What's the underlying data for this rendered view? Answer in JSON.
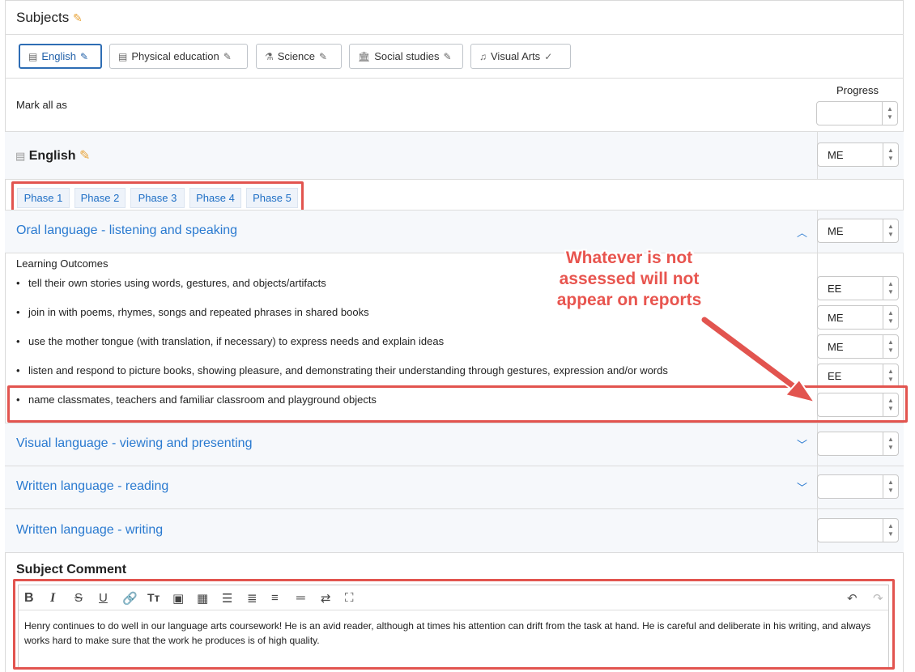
{
  "header": {
    "title": "Subjects"
  },
  "subjects": [
    {
      "label": "English",
      "icon": "document-icon",
      "active": true
    },
    {
      "label": "Physical education",
      "icon": "document-icon",
      "active": false
    },
    {
      "label": "Science",
      "icon": "flask-icon",
      "active": false
    },
    {
      "label": "Social studies",
      "icon": "building-icon",
      "active": false
    },
    {
      "label": "Visual Arts",
      "icon": "music-icon",
      "active": false
    }
  ],
  "progress_header": "Progress",
  "mark_all": {
    "label": "Mark all as",
    "value": ""
  },
  "subject": {
    "title": "English",
    "value": "ME"
  },
  "phases": [
    "Phase 1",
    "Phase 2",
    "Phase 3",
    "Phase 4",
    "Phase 5"
  ],
  "sections": {
    "oral": {
      "title": "Oral language - listening and speaking",
      "value": "ME"
    },
    "outcomes_label": "Learning Outcomes",
    "outcomes": [
      {
        "text": "tell their own stories using words, gestures, and objects/artifacts",
        "value": "EE"
      },
      {
        "text": "join in with poems, rhymes, songs and repeated phrases in shared books",
        "value": "ME"
      },
      {
        "text": "use the mother tongue (with translation, if necessary) to express needs and explain ideas",
        "value": "ME"
      },
      {
        "text": "listen and respond to picture books, showing pleasure, and demonstrating their understanding through gestures, expression and/or words",
        "value": "EE"
      },
      {
        "text": "name classmates, teachers and familiar classroom and playground objects",
        "value": ""
      }
    ],
    "visual": {
      "title": "Visual language - viewing and presenting",
      "value": ""
    },
    "reading": {
      "title": "Written language - reading",
      "value": ""
    },
    "writing": {
      "title": "Written language - writing",
      "value": ""
    }
  },
  "comment": {
    "label": "Subject Comment",
    "text": "Henry continues to do well in our language arts coursework! He is an avid reader, although at times his attention can drift from the task at hand. He is careful and deliberate in his writing, and always works hard to make sure that the work he produces is of high quality."
  },
  "annotation": {
    "text": "Whatever is not assessed will not appear on reports"
  },
  "colors": {
    "accent": "#2a7ad0",
    "annotation": "#e2544f",
    "pencil": "#e8a43a"
  }
}
